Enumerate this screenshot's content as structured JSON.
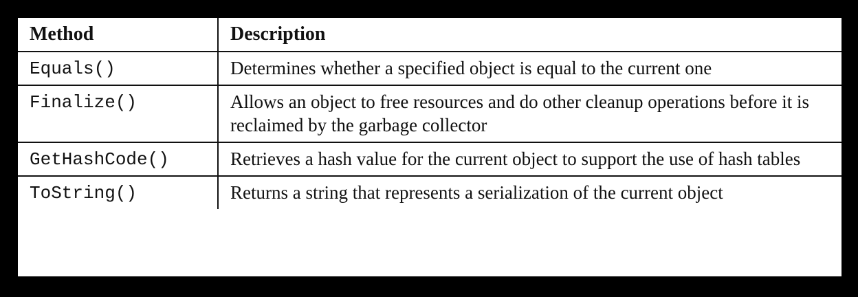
{
  "table": {
    "headers": {
      "method": "Method",
      "description": "Description"
    },
    "rows": [
      {
        "method": "Equals()",
        "description": "Determines whether a specified object is equal to the current one"
      },
      {
        "method": "Finalize()",
        "description": "Allows an object to free resources and do other cleanup operations before it is reclaimed by the garbage collector"
      },
      {
        "method": "GetHashCode()",
        "description": "Retrieves a hash value for the current object to support the use of hash tables"
      },
      {
        "method": "ToString()",
        "description": "Returns a string that represents a serialization of the current object"
      }
    ]
  }
}
